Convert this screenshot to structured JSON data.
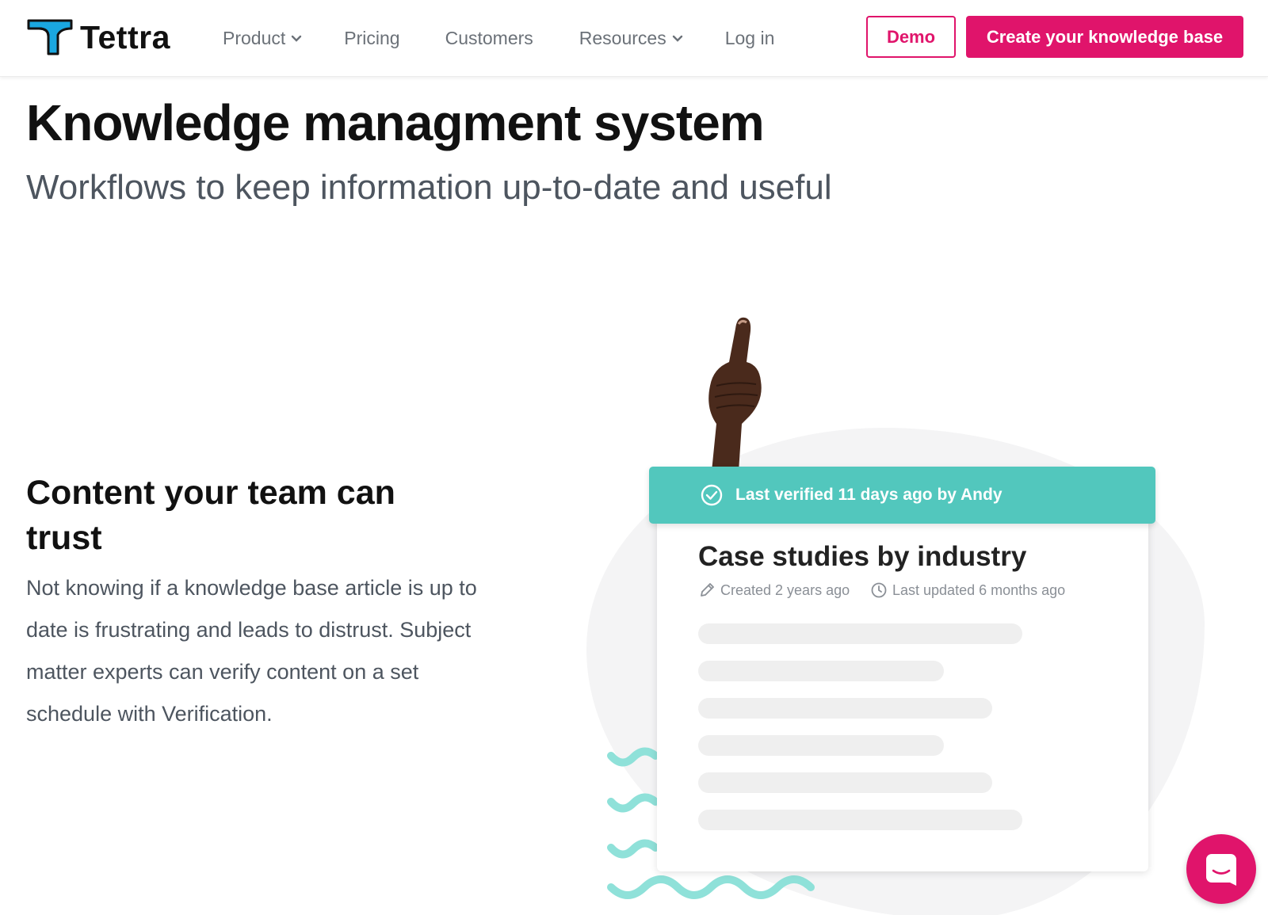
{
  "brand": {
    "name": "Tettra",
    "accent": "#e0146b",
    "teal": "#52c7bd"
  },
  "nav": {
    "items": [
      {
        "label": "Product",
        "has_dropdown": true
      },
      {
        "label": "Pricing",
        "has_dropdown": false
      },
      {
        "label": "Customers",
        "has_dropdown": false
      },
      {
        "label": "Resources",
        "has_dropdown": true
      },
      {
        "label": "Log in",
        "has_dropdown": false
      }
    ],
    "demo_label": "Demo",
    "create_label": "Create your knowledge base"
  },
  "hero": {
    "title": "Knowledge managment system",
    "subtitle": "Workflows to keep information up-to-date and useful"
  },
  "feature": {
    "title": "Content your team can trust",
    "body": "Not knowing if a knowledge base article is up to date is frustrating and leads to distrust. Subject matter experts can verify content on a set schedule with Verification."
  },
  "card": {
    "verified_text": "Last verified 11 days ago  by Andy",
    "title": "Case studies by industry",
    "created": "Created 2 years ago",
    "updated": "Last updated 6 months ago"
  },
  "icons": {
    "logo": "tettra-logo-icon",
    "chevron": "chevron-down-icon",
    "verified": "check-circle-icon",
    "created": "pencil-icon",
    "updated": "clock-icon",
    "chat": "chat-bubble-icon"
  }
}
